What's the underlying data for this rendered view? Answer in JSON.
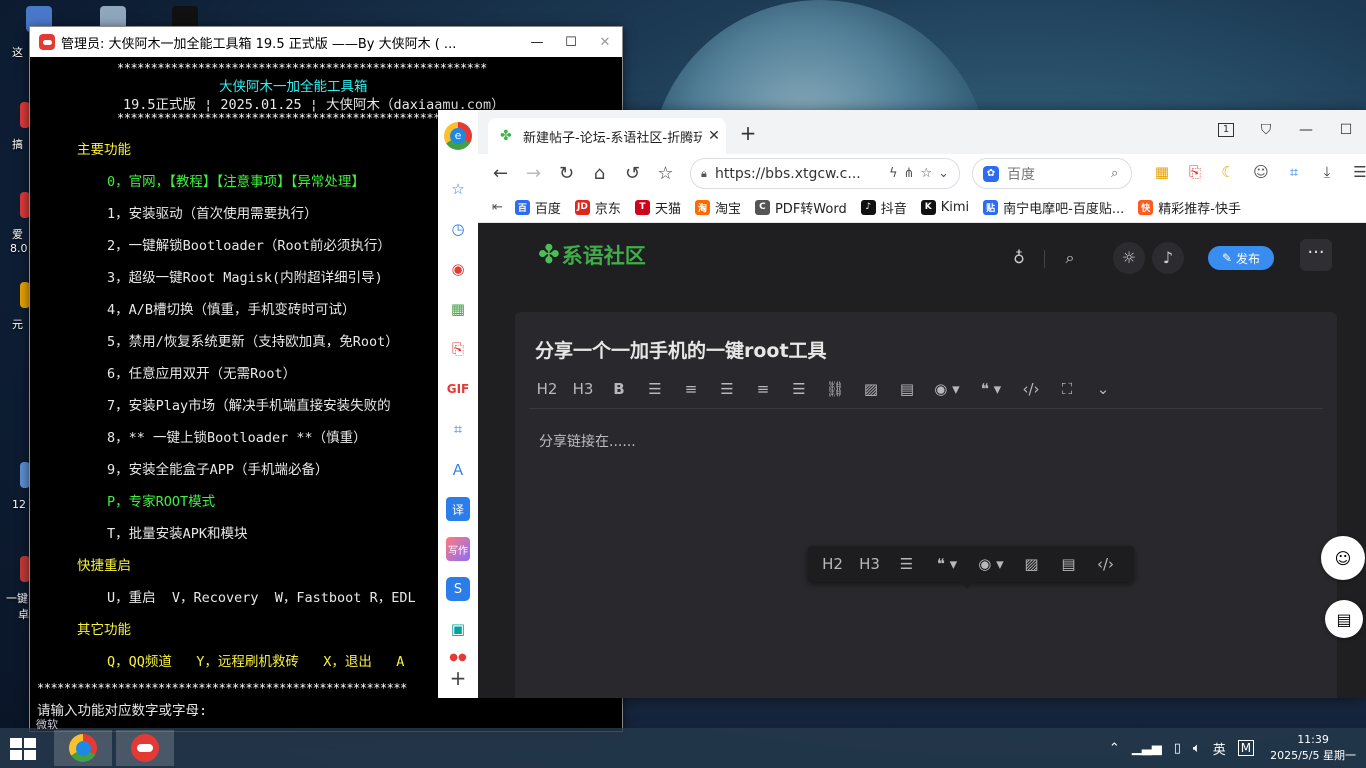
{
  "desktop": {
    "labels": [
      "这",
      "搞",
      "爱",
      "8.0",
      "元",
      "12",
      "一键",
      "卓"
    ],
    "taskbar_search_hint": "微软"
  },
  "console": {
    "title": "管理员: 大侠阿木一加全能工具箱 19.5 正式版 ——By 大侠阿木 ( ...",
    "stars": "*******************************************************",
    "banner_title": "大侠阿木一加全能工具箱",
    "banner_version": "19.5正式版 ¦ 2025.01.25 ¦ 大侠阿木（daxiaamu.com）",
    "section_main": "主要功能",
    "line0": "0，官网，【教程】【注意事项】【异常处理】",
    "line1": "1，安装驱动（首次使用需要执行）",
    "line2": "2，一键解锁Bootloader（Root前必须执行）",
    "line3": "3，超级一键Root Magisk(内附超详细引导)",
    "line4": "4，A/B槽切换（慎重，手机变砖时可试）",
    "line5": "5，禁用/恢复系统更新（支持欧加真，免Root）",
    "line6": "6，任意应用双开（无需Root）",
    "line7": "7，安装Play市场（解决手机端直接安装失败的",
    "line8": "8，** 一键上锁Bootloader **（慎重）",
    "line9": "9，安装全能盒子APP（手机端必备）",
    "lineP": "P，专家ROOT模式",
    "lineT": "T，批量安装APK和模块",
    "section_reboot": "快捷重启",
    "reboot_line": "U，重启  V，Recovery  W，Fastboot R，EDL",
    "section_other": "其它功能",
    "other_line": "Q，QQ频道   Y，远程刷机救砖   X，退出   A",
    "prompt": "请输入功能对应数字或字母:"
  },
  "browser": {
    "tab_title": "新建帖子-论坛-系语社区-折腾玩",
    "tab_count": "1",
    "url": "https://bbs.xtgcw.c...",
    "search_placeholder": "百度",
    "bookmarks": [
      {
        "label": "百度",
        "color": "#2d6cf0",
        "glyph": "百"
      },
      {
        "label": "京东",
        "color": "#e1251b",
        "glyph": "JD"
      },
      {
        "label": "天猫",
        "color": "#d0021b",
        "glyph": "T"
      },
      {
        "label": "淘宝",
        "color": "#ff6a00",
        "glyph": "淘"
      },
      {
        "label": "PDF转Word",
        "color": "#555555",
        "glyph": "C"
      },
      {
        "label": "抖音",
        "color": "#111111",
        "glyph": "♪"
      },
      {
        "label": "Kimi",
        "color": "#111111",
        "glyph": "K"
      },
      {
        "label": "南宁电摩吧-百度贴...",
        "color": "#2d6cf0",
        "glyph": "贴"
      },
      {
        "label": "精彩推荐-快手",
        "color": "#ff5a1f",
        "glyph": "快"
      }
    ]
  },
  "site": {
    "logo_text": "系语社区",
    "publish_label": "发布",
    "post_title": "分享一个一加手机的一键root工具",
    "toolbar": {
      "h2": "H2",
      "h3": "H3",
      "bold": "B"
    },
    "content": "分享链接在......"
  },
  "taskbar": {
    "time": "11:39",
    "date": "2025/5/5 星期一",
    "ime": "英",
    "ime_mode": "M"
  }
}
